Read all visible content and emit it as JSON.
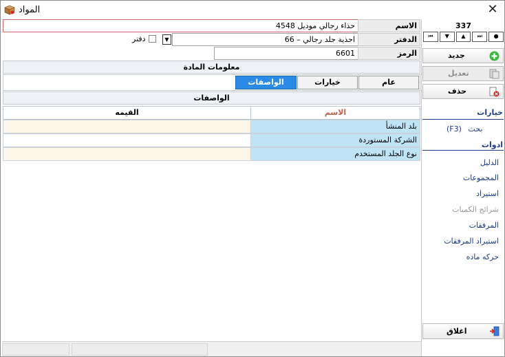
{
  "window": {
    "title": "المواد"
  },
  "form": {
    "name_label": "الاسم",
    "name_value": "حذاء رجالي موديل 4548",
    "book_label": "الدفتر",
    "book_value": "66 – احذية جلد رجالي",
    "book_checkbox_label": "دفتر",
    "code_label": "الرمز",
    "code_value": "6601"
  },
  "section": {
    "item_info": "معلومات المادة",
    "specs_header": "الواصفات"
  },
  "tabs": [
    {
      "label": "عام"
    },
    {
      "label": "خيارات"
    },
    {
      "label": "الواصفات"
    }
  ],
  "grid": {
    "headers": {
      "name": "الاسم",
      "value": "القيمه"
    },
    "rows": [
      {
        "name": "بلد المنشأ",
        "value": ""
      },
      {
        "name": "الشركة المستوردة",
        "value": ""
      },
      {
        "name": "نوع الجلد المستخدم",
        "value": ""
      }
    ]
  },
  "sidebar": {
    "counter": "337",
    "nav": [
      "⏮",
      "▼",
      "▲",
      "⏭",
      "●"
    ],
    "new_label": "جديد",
    "edit_label": "تعديل",
    "delete_label": "حذف",
    "options_section": "خيارات",
    "search_label": "بحث",
    "search_shortcut": "(F3)",
    "tools_section": "ادوات",
    "links": [
      {
        "label": "الدليل",
        "enabled": true
      },
      {
        "label": "المجموعات",
        "enabled": true
      },
      {
        "label": "استيراد",
        "enabled": true
      },
      {
        "label": "شرائح الكميات",
        "enabled": false
      },
      {
        "label": "المرفقات",
        "enabled": true
      },
      {
        "label": "استيراد المرفقات",
        "enabled": true
      },
      {
        "label": "حركه ماده",
        "enabled": true
      }
    ],
    "close_label": "اغلاق"
  },
  "colors": {
    "accent": "#2a8ae6",
    "link": "#1b3a8a",
    "name_cell": "#bfe4f5",
    "value_cell": "#fdf6e8",
    "header_name": "#c0604a"
  }
}
